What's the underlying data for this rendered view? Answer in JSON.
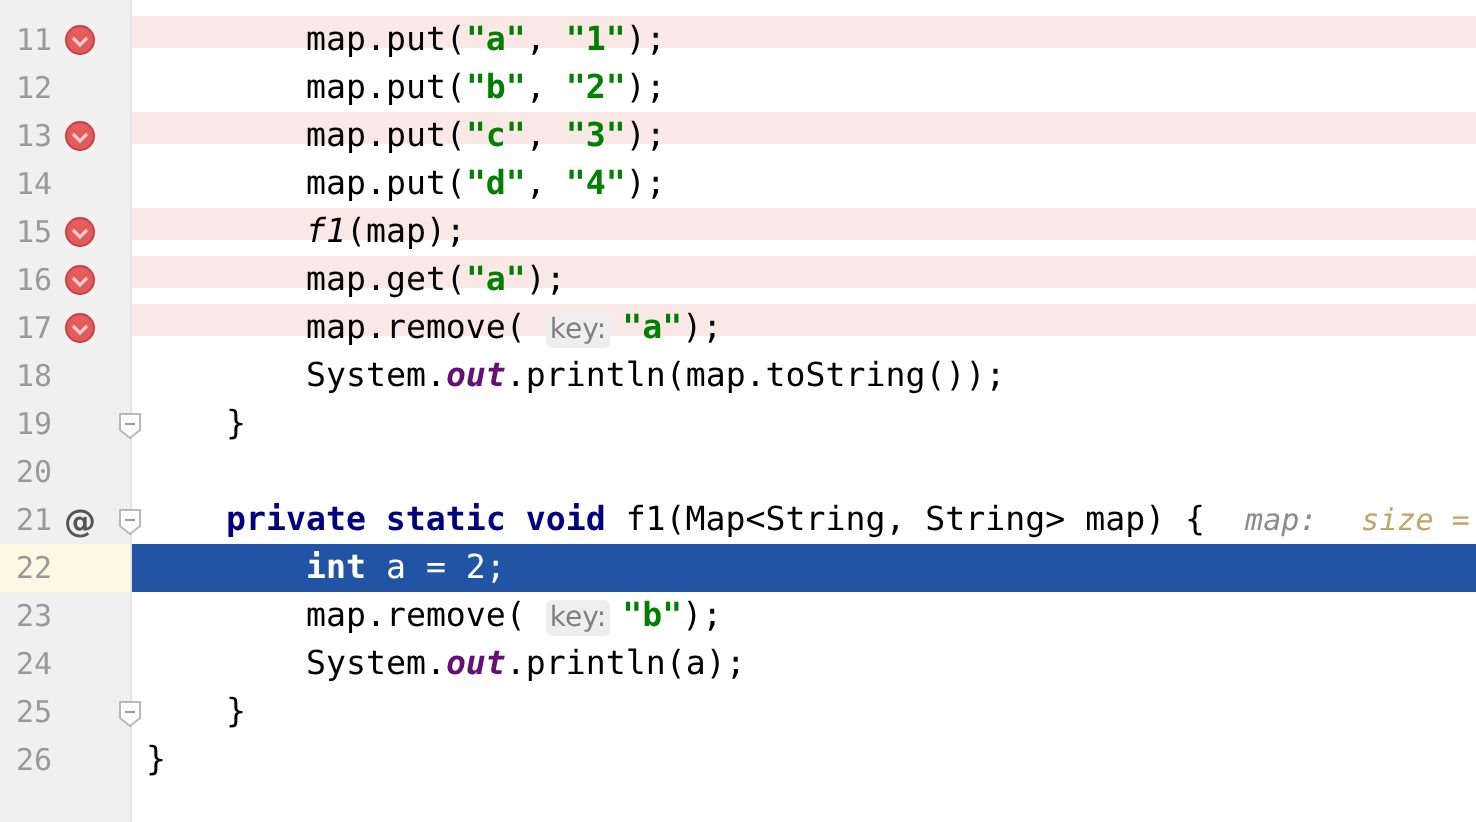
{
  "editor": {
    "lines": [
      {
        "children": [
          {
            "children": [
              {
                "number": "11",
                "breakpoint": true,
                "current": false,
                "fold": false,
                "tokens": [
                  {
                    "kind": "plain",
                    "text": "map.put("
                  },
                  {
                    "kind": "string",
                    "text": "\"a\""
                  },
                  {
                    "kind": "plain",
                    "text": ", "
                  },
                  {
                    "kind": "string",
                    "text": "\"1\""
                  },
                  {
                    "kind": "plain",
                    "text": ");"
                  }
                ]
              },
              {
                "number": "12",
                "breakpoint": false,
                "current": false,
                "fold": false,
                "tokens": [
                  {
                    "kind": "plain",
                    "text": "map.put("
                  },
                  {
                    "kind": "string",
                    "text": "\"b\""
                  },
                  {
                    "kind": "plain",
                    "text": ", "
                  },
                  {
                    "kind": "string",
                    "text": "\"2\""
                  },
                  {
                    "kind": "plain",
                    "text": ");"
                  }
                ]
              },
              {
                "number": "13",
                "breakpoint": true,
                "current": false,
                "fold": false,
                "tokens": [
                  {
                    "kind": "plain",
                    "text": "map.put("
                  },
                  {
                    "kind": "string",
                    "text": "\"c\""
                  },
                  {
                    "kind": "plain",
                    "text": ", "
                  },
                  {
                    "kind": "string",
                    "text": "\"3\""
                  },
                  {
                    "kind": "plain",
                    "text": ");"
                  }
                ]
              },
              {
                "number": "14",
                "breakpoint": false,
                "current": false,
                "fold": false,
                "tokens": [
                  {
                    "kind": "plain",
                    "text": "map.put("
                  },
                  {
                    "kind": "string",
                    "text": "\"d\""
                  },
                  {
                    "kind": "plain",
                    "text": ", "
                  },
                  {
                    "kind": "string",
                    "text": "\"4\""
                  },
                  {
                    "kind": "plain",
                    "text": ");"
                  }
                ]
              },
              {
                "number": "15",
                "breakpoint": true,
                "current": false,
                "fold": false,
                "tokens": [
                  {
                    "kind": "method",
                    "text": "f1"
                  },
                  {
                    "kind": "plain",
                    "text": "(map);"
                  }
                ]
              },
              {
                "number": "16",
                "breakpoint": true,
                "current": false,
                "fold": false,
                "tokens": [
                  {
                    "kind": "plain",
                    "text": "map.get("
                  },
                  {
                    "kind": "string",
                    "text": "\"a\""
                  },
                  {
                    "kind": "plain",
                    "text": ");"
                  }
                ]
              },
              {
                "number": "17",
                "breakpoint": true,
                "current": false,
                "fold": false,
                "tokens": [
                  {
                    "kind": "plain",
                    "text": "map.remove( "
                  },
                  {
                    "kind": "hint",
                    "text": "key:"
                  },
                  {
                    "kind": "string",
                    "text": "\"a\""
                  },
                  {
                    "kind": "plain",
                    "text": ");"
                  }
                ]
              },
              {
                "number": "18",
                "breakpoint": false,
                "current": false,
                "fold": false,
                "tokens": [
                  {
                    "kind": "plain",
                    "text": "System."
                  },
                  {
                    "kind": "field",
                    "text": "out"
                  },
                  {
                    "kind": "plain",
                    "text": ".println(map.toString());"
                  }
                ]
              }
            ]
          },
          {
            "number": "19",
            "breakpoint": false,
            "current": false,
            "fold": true,
            "tokens": [
              {
                "kind": "plain",
                "text": "}"
              }
            ]
          },
          {
            "number": "20",
            "breakpoint": false,
            "current": false,
            "fold": false
          },
          {
            "number": "21",
            "breakpoint": false,
            "current": false,
            "fold": true,
            "mark": "@",
            "tokens": [
              {
                "kind": "keyword",
                "text": "private static void"
              },
              {
                "kind": "plain",
                "text": " f1(Map<String, String> map) {"
              },
              {
                "kind": "value-name",
                "text": "map:"
              },
              {
                "kind": "value",
                "text": "size ="
              }
            ],
            "children": [
              {
                "number": "22",
                "breakpoint": false,
                "current": true,
                "fold": false,
                "tokens": [
                  {
                    "kind": "keyword",
                    "text": "int"
                  },
                  {
                    "kind": "plain",
                    "text": " a = 2;"
                  }
                ]
              },
              {
                "number": "23",
                "breakpoint": false,
                "current": false,
                "fold": false,
                "tokens": [
                  {
                    "kind": "plain",
                    "text": "map.remove( "
                  },
                  {
                    "kind": "hint",
                    "text": "key:"
                  },
                  {
                    "kind": "string",
                    "text": "\"b\""
                  },
                  {
                    "kind": "plain",
                    "text": ");"
                  }
                ]
              },
              {
                "number": "24",
                "breakpoint": false,
                "current": false,
                "fold": false,
                "tokens": [
                  {
                    "kind": "plain",
                    "text": "System."
                  },
                  {
                    "kind": "field",
                    "text": "out"
                  },
                  {
                    "kind": "plain",
                    "text": ".println(a);"
                  }
                ]
              }
            ]
          },
          {
            "number": "25",
            "breakpoint": false,
            "current": false,
            "fold": true,
            "tokens": [
              {
                "kind": "plain",
                "text": "}"
              }
            ]
          }
        ]
      },
      {
        "number": "26",
        "breakpoint": false,
        "current": false,
        "fold": false,
        "tokens": [
          {
            "kind": "plain",
            "text": "}"
          }
        ]
      }
    ]
  }
}
